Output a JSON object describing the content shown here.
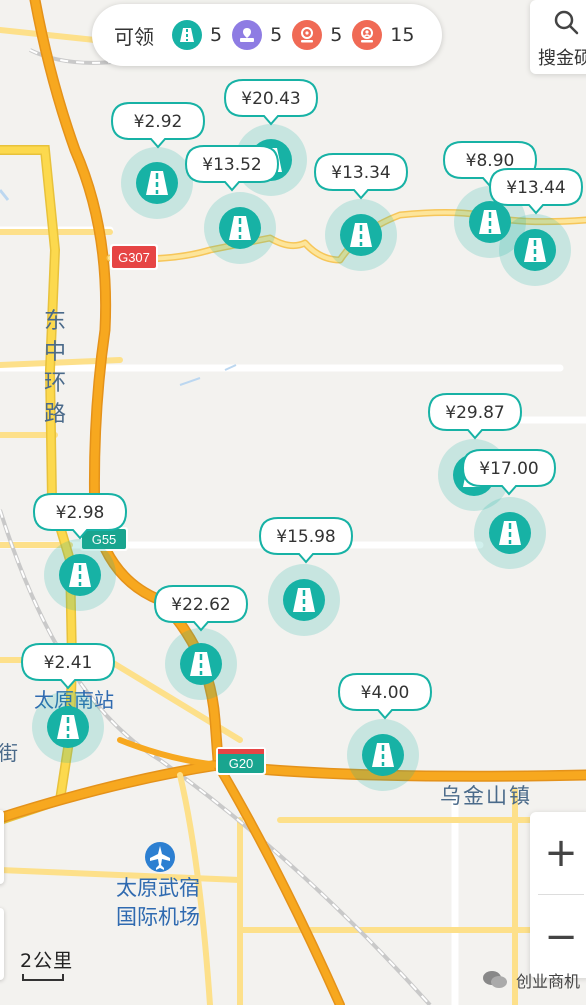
{
  "summary": {
    "label": "可领",
    "items": [
      {
        "icon": "road-icon",
        "color": "#17b2a5",
        "count": "5"
      },
      {
        "icon": "location-card-icon",
        "color": "#8e7ce3",
        "count": "5"
      },
      {
        "icon": "map-pin-icon",
        "color": "#f06a55",
        "count": "5"
      },
      {
        "icon": "person-pin-icon",
        "color": "#f06a55",
        "count": "15"
      }
    ]
  },
  "search": {
    "label": "搜金硕"
  },
  "markers": [
    {
      "price": "¥2.92"
    },
    {
      "price": "¥20.43"
    },
    {
      "price": "¥13.52"
    },
    {
      "price": "¥13.34"
    },
    {
      "price": "¥8.90"
    },
    {
      "price": "¥13.44"
    },
    {
      "price": "¥29.87"
    },
    {
      "price": "¥17.00"
    },
    {
      "price": "¥2.98"
    },
    {
      "price": "¥15.98"
    },
    {
      "price": "¥22.62"
    },
    {
      "price": "¥2.41"
    },
    {
      "price": "¥4.00"
    }
  ],
  "map_labels": {
    "road_east_ring": "东中环路",
    "station": "太原南站",
    "airport": "太原武宿国际机场",
    "town": "乌金山镇",
    "street_fragment": "大街",
    "shield_g307": "G307",
    "shield_g55": "G55",
    "shield_g20": "G20"
  },
  "controls": {
    "zoom_in": "+",
    "zoom_out": "−"
  },
  "scale": {
    "label": "2公里"
  },
  "watermark": {
    "label": "创业商机"
  },
  "colors": {
    "accent": "#17b2a5",
    "road_major": "#f7a81f",
    "road_minor": "#fde08a",
    "shield_red": "#e64545",
    "shield_green": "#19a58f"
  }
}
